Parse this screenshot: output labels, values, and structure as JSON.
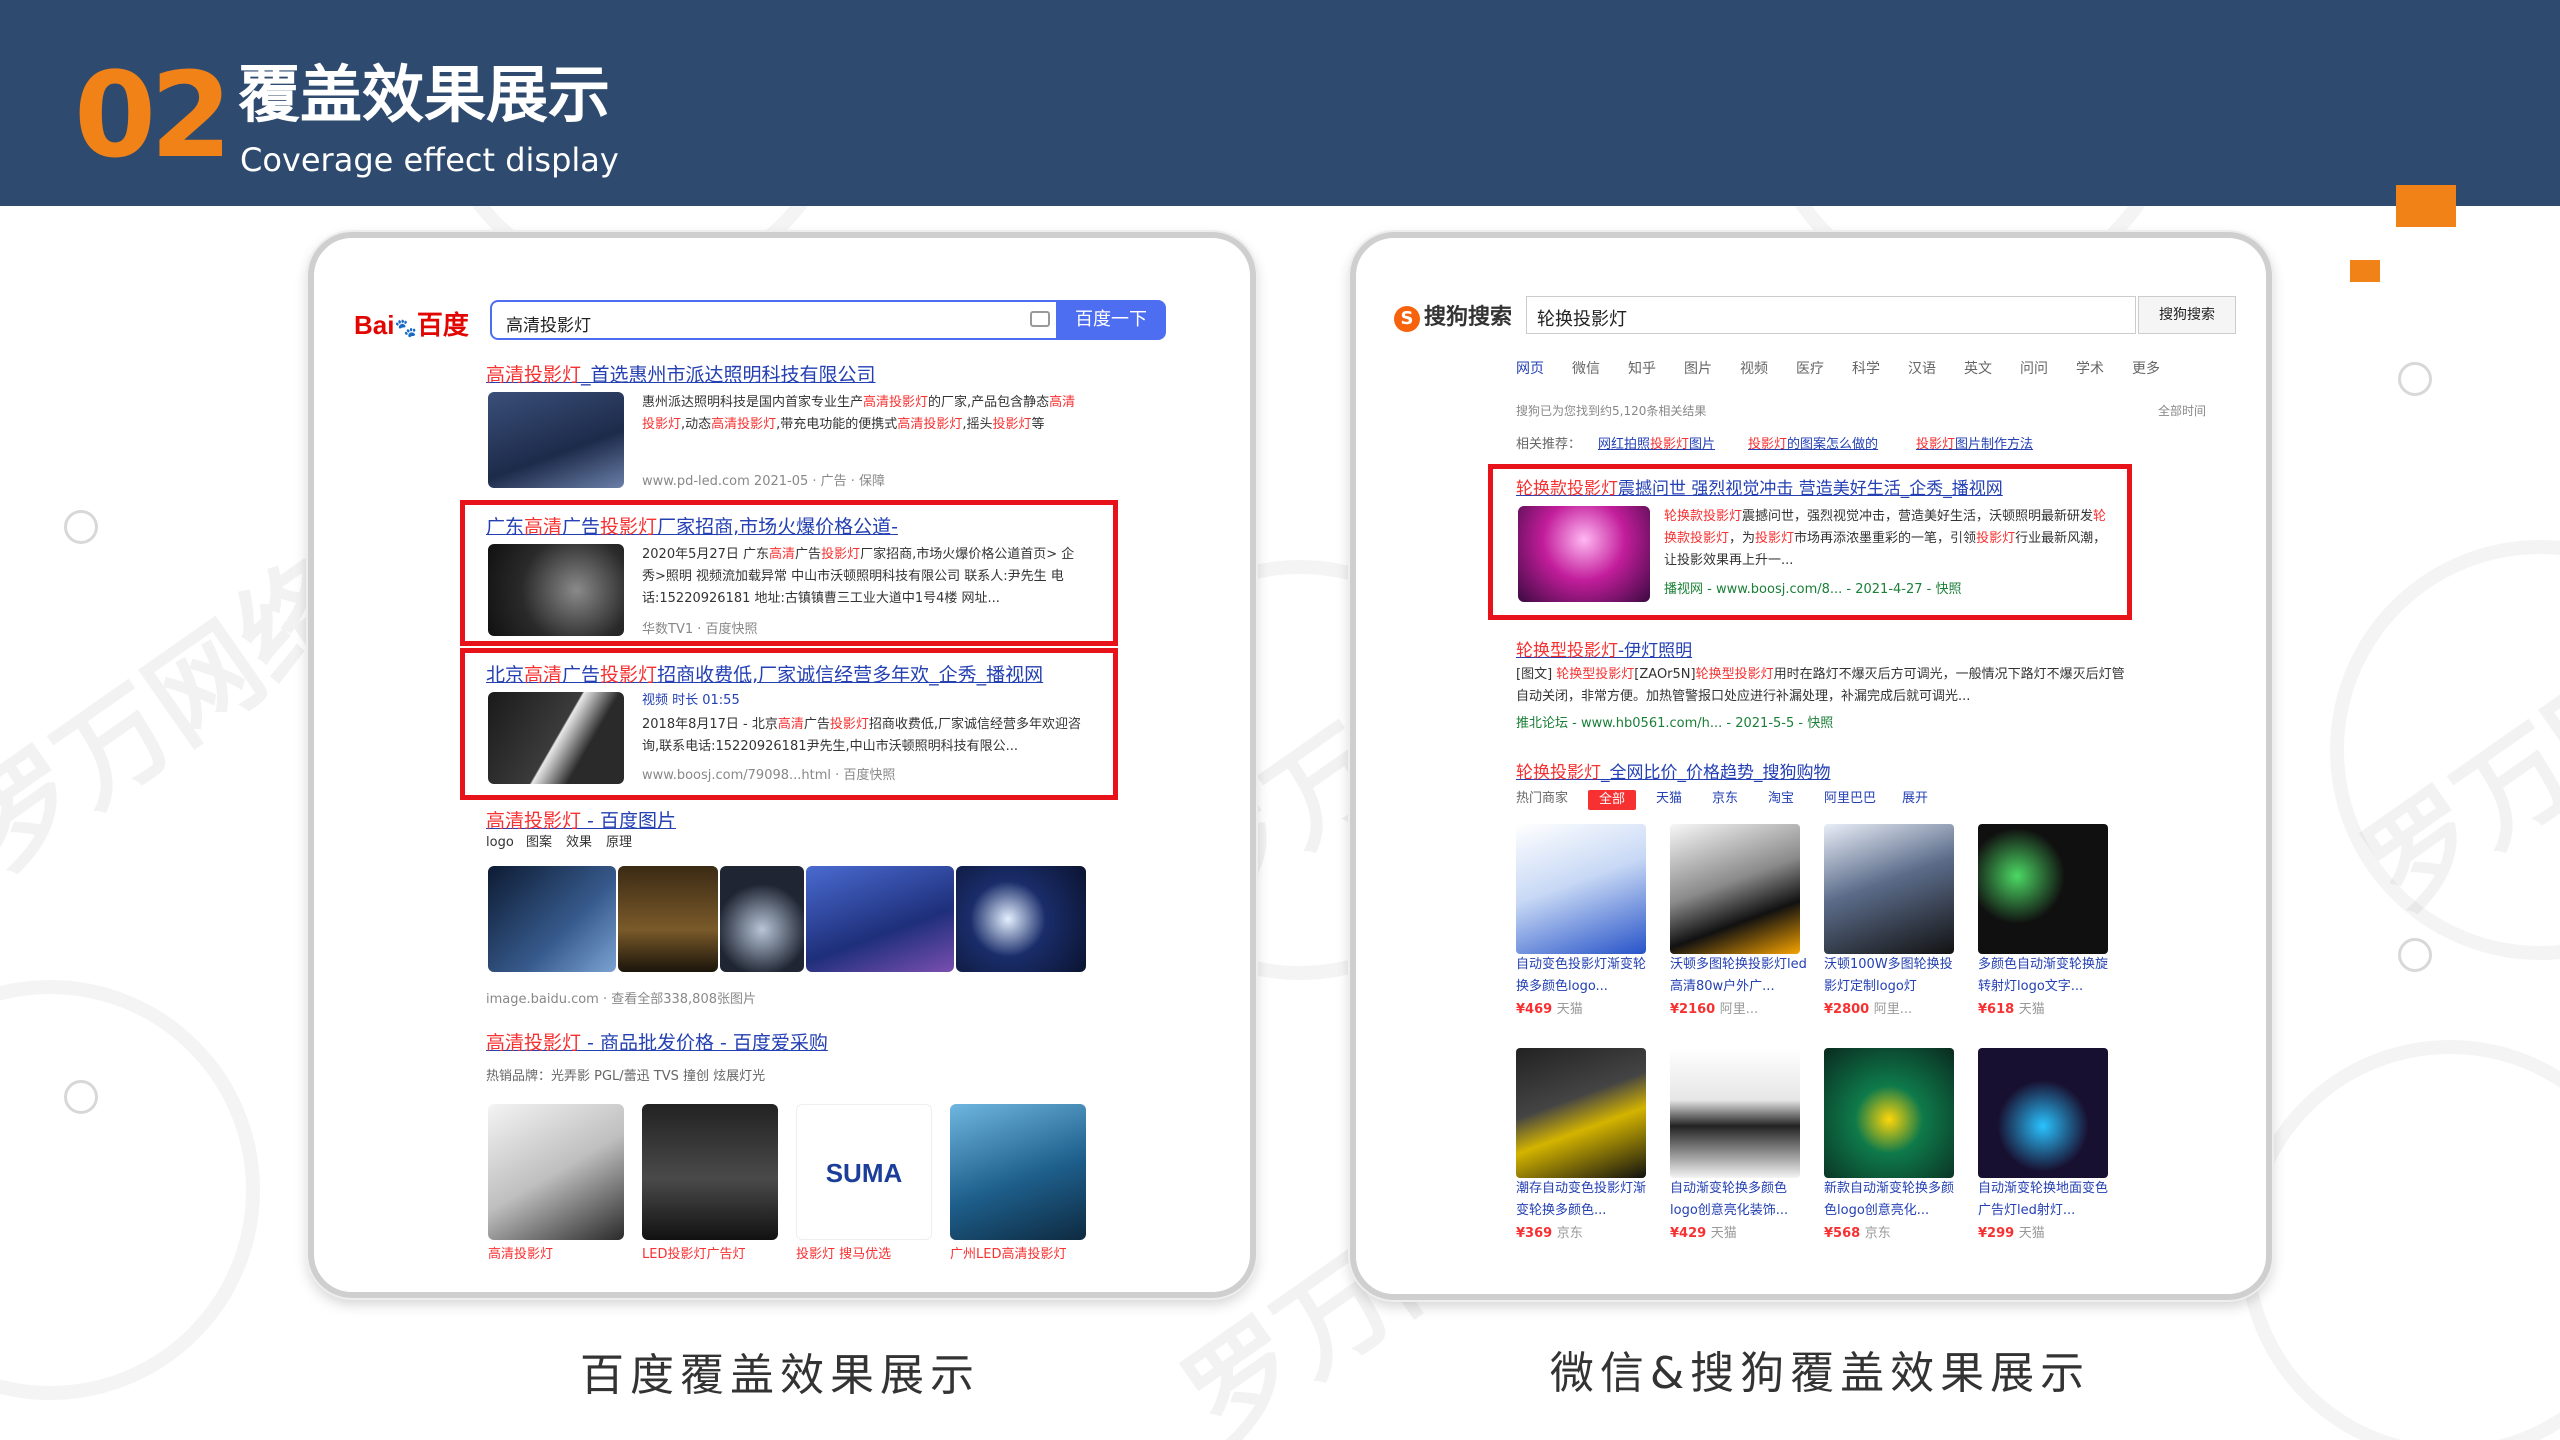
{
  "header": {
    "number": "02",
    "title": "覆盖效果展示",
    "subtitle": "Coverage effect display"
  },
  "watermark_text": "罗万网络",
  "captions": {
    "left": "百度覆盖效果展示",
    "right": "微信&搜狗覆盖效果展示"
  },
  "colors": {
    "header_bg": "#2e4a6e",
    "accent_orange": "#f08218",
    "highlight_red": "#e8121b",
    "link_blue": "#2440b3"
  },
  "baidu": {
    "logo": "Bai百度",
    "query": "高清投影灯",
    "search_button": "百度一下",
    "results": [
      {
        "title": "高清投影灯_首选惠州市派达照明科技有限公司",
        "desc": "惠州派达照明科技是国内首家专业生产高清投影灯的厂家,产品包含静态高清投影灯,动态高清投影灯,带充电功能的便携式高清投影灯,摇头投影灯等",
        "url": "www.pd-led.com 2021-05 · 广告 · 保障"
      },
      {
        "title": "广东高清广告投影灯厂家招商,市场火爆价格公道-",
        "desc": "2020年5月27日 广东高清广告投影灯厂家招商,市场火爆价格公道首页> 企秀>照明 视频流加载异常 中山市沃顿照明科技有限公司 联系人:尹先生 电话:15220926181 地址:古镇镇曹三工业大道中1号4楼 网址...",
        "url": "华数TV1 · 百度快照"
      },
      {
        "title": "北京高清广告投影灯招商收费低,厂家诚信经营多年欢_企秀_播视网",
        "video": "视频 时长 01:55",
        "desc": "2018年8月17日 - 北京高清广告投影灯招商收费低,厂家诚信经营多年欢迎咨询,联系电话:15220926181尹先生,中山市沃顿照明科技有限公...",
        "url": "www.boosj.com/79098...html · 百度快照"
      }
    ],
    "images_result": {
      "title": "高清投影灯 - 百度图片",
      "tags": [
        "logo",
        "图案",
        "效果",
        "原理"
      ],
      "url": "image.baidu.com · 查看全部338,808张图片"
    },
    "shop_result": {
      "title": "高清投影灯 - 商品批发价格 - 百度爱采购",
      "brands": "热销品牌：光弄影 PGL/蕾迅 TVS 撞创 炫展灯光",
      "items": [
        "高清投影灯",
        "LED投影灯广告灯",
        "投影灯 搜马优选",
        "广州LED高清投影灯"
      ]
    }
  },
  "sogou": {
    "logo": "搜狗搜索",
    "query": "轮换投影灯",
    "search_button": "搜狗搜索",
    "tabs": [
      "网页",
      "微信",
      "知乎",
      "图片",
      "视频",
      "医疗",
      "科学",
      "汉语",
      "英文",
      "问问",
      "学术",
      "更多"
    ],
    "result_count": "搜狗已为您找到约5,120条相关结果",
    "filter": "全部时间",
    "related_label": "相关推荐：",
    "related": [
      "网红拍照投影灯图片",
      "投影灯的图案怎么做的",
      "投影灯图片制作方法"
    ],
    "results": [
      {
        "title": "轮换款投影灯震撼问世 强烈视觉冲击 营造美好生活_企秀_播视网",
        "desc": "轮换款投影灯震撼问世，强烈视觉冲击，营造美好生活，沃顿照明最新研发轮换款投影灯，为投影灯市场再添浓墨重彩的一笔，引领投影灯行业最新风潮，让投影效果再上升一...",
        "url": "播视网 - www.boosj.com/8... - 2021-4-27 - 快照"
      },
      {
        "title": "轮换型投影灯-伊灯照明",
        "desc": "[图文] 轮换型投影灯[ZAOr5N]轮换型投影灯用时在路灯不爆灭后方可调光，一般情况下路灯不爆灭后灯管自动关闭，非常方便。加热管警报口处应进行补漏处理，补漏完成后就可调光...",
        "url": "推北论坛 - www.hb0561.com/h... - 2021-5-5 - 快照"
      }
    ],
    "shop_title": "轮换投影灯_全网比价_价格趋势_搜狗购物",
    "shop_filter_label": "热门商家",
    "shop_filters": [
      "全部",
      "天猫",
      "京东",
      "淘宝",
      "阿里巴巴",
      "展开"
    ],
    "products": [
      {
        "name": "自动变色投影灯渐变轮换多颜色logo...",
        "price": "¥469",
        "store": "天猫"
      },
      {
        "name": "沃顿多图轮换投影灯led高清80w户外广...",
        "price": "¥2160",
        "store": "阿里..."
      },
      {
        "name": "沃顿100W多图轮换投影灯定制logo灯",
        "price": "¥2800",
        "store": "阿里..."
      },
      {
        "name": "多颜色自动渐变轮换旋转射灯logo文字...",
        "price": "¥618",
        "store": "天猫"
      },
      {
        "name": "潮存自动变色投影灯渐变轮换多颜色...",
        "price": "¥369",
        "store": "京东"
      },
      {
        "name": "自动渐变轮换多颜色logo创意亮化装饰...",
        "price": "¥429",
        "store": "天猫"
      },
      {
        "name": "新款自动渐变轮换多颜色logo创意亮化...",
        "price": "¥568",
        "store": "京东"
      },
      {
        "name": "自动渐变轮换地面变色广告灯led射灯...",
        "price": "¥299",
        "store": "天猫"
      }
    ]
  }
}
